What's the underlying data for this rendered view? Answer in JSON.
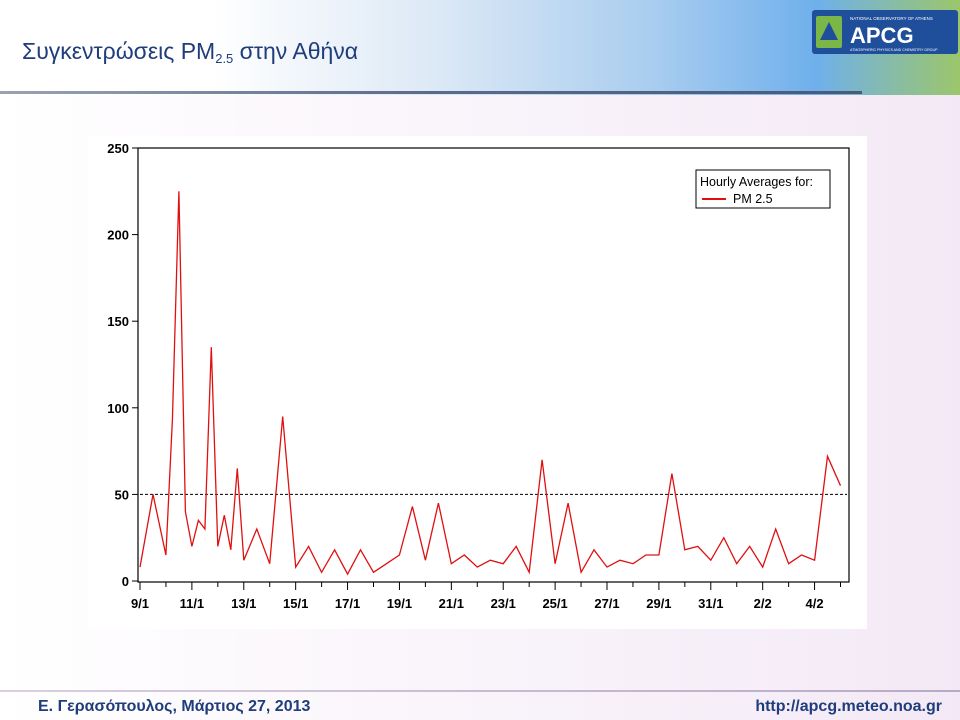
{
  "header": {
    "title_main": "Συγκεντρώσεις PM",
    "title_sub": "2.5",
    "title_rest": " στην Αθήνα"
  },
  "logo": {
    "text": "APCG",
    "tagline_top": "NATIONAL OBSERVATORY OF ATHENS",
    "tagline_bottom": "ATMOSPHERIC PHYSICS AND CHEMISTRY GROUP",
    "colors": {
      "blue": "#1f4e9a",
      "green": "#7ab648",
      "text": "#ffffff"
    }
  },
  "footer": {
    "author_date": "Ε. Γερασόπουλος, Μάρτιος 27, 2013",
    "url": "http://apcg.meteo.noa.gr"
  },
  "chart_data": {
    "type": "line",
    "title": "",
    "xlabel": "",
    "ylabel": "",
    "ylim": [
      0,
      250
    ],
    "xlim_days": [
      "9/1",
      "5/2"
    ],
    "yticks": [
      0,
      50,
      100,
      150,
      200,
      250
    ],
    "xticks": [
      "9/1",
      "11/1",
      "13/1",
      "15/1",
      "17/1",
      "19/1",
      "21/1",
      "23/1",
      "25/1",
      "27/1",
      "29/1",
      "31/1",
      "2/2",
      "4/2"
    ],
    "reference_line": {
      "y": 50,
      "style": "dashed"
    },
    "legend": {
      "title": "Hourly Averages for:",
      "placement": "top-right"
    },
    "series": [
      {
        "name": "PM 2.5",
        "color": "#e01010",
        "x": [
          "9/1 00:00",
          "9/1 12:00",
          "10/1 00:00",
          "10/1 06:00",
          "10/1 12:00",
          "10/1 18:00",
          "11/1 00:00",
          "11/1 06:00",
          "11/1 12:00",
          "11/1 18:00",
          "12/1 00:00",
          "12/1 06:00",
          "12/1 12:00",
          "12/1 18:00",
          "13/1 00:00",
          "13/1 12:00",
          "14/1 00:00",
          "14/1 12:00",
          "15/1 00:00",
          "15/1 12:00",
          "16/1 00:00",
          "16/1 12:00",
          "17/1 00:00",
          "17/1 12:00",
          "18/1 00:00",
          "18/1 12:00",
          "19/1 00:00",
          "19/1 12:00",
          "20/1 00:00",
          "20/1 12:00",
          "21/1 00:00",
          "21/1 12:00",
          "22/1 00:00",
          "22/1 12:00",
          "23/1 00:00",
          "23/1 12:00",
          "24/1 00:00",
          "24/1 12:00",
          "25/1 00:00",
          "25/1 12:00",
          "26/1 00:00",
          "26/1 12:00",
          "27/1 00:00",
          "27/1 12:00",
          "28/1 00:00",
          "28/1 12:00",
          "29/1 00:00",
          "29/1 12:00",
          "30/1 00:00",
          "30/1 12:00",
          "31/1 00:00",
          "31/1 12:00",
          "1/2 00:00",
          "1/2 12:00",
          "2/2 00:00",
          "2/2 12:00",
          "3/2 00:00",
          "3/2 12:00",
          "4/2 00:00",
          "4/2 12:00",
          "5/2 00:00"
        ],
        "values": [
          8,
          50,
          15,
          93,
          225,
          40,
          20,
          35,
          30,
          135,
          20,
          38,
          18,
          65,
          12,
          30,
          10,
          95,
          8,
          20,
          5,
          18,
          4,
          18,
          5,
          10,
          15,
          43,
          12,
          45,
          10,
          15,
          8,
          12,
          10,
          20,
          5,
          70,
          10,
          45,
          5,
          18,
          8,
          12,
          10,
          15,
          15,
          62,
          18,
          20,
          12,
          25,
          10,
          20,
          8,
          30,
          10,
          15,
          12,
          72,
          55
        ]
      }
    ]
  }
}
